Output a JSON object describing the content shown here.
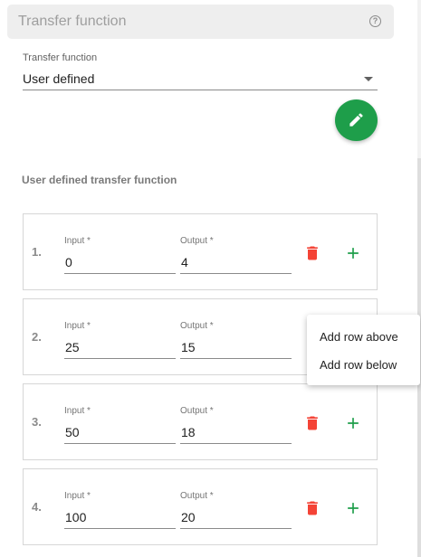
{
  "header": {
    "title": "Transfer function"
  },
  "select": {
    "label": "Transfer function",
    "value": "User defined"
  },
  "section": {
    "title": "User defined transfer function"
  },
  "rows": [
    {
      "index": "1.",
      "input_label": "Input *",
      "input": "0",
      "output_label": "Output *",
      "output": "4"
    },
    {
      "index": "2.",
      "input_label": "Input *",
      "input": "25",
      "output_label": "Output *",
      "output": "15"
    },
    {
      "index": "3.",
      "input_label": "Input *",
      "input": "50",
      "output_label": "Output *",
      "output": "18"
    },
    {
      "index": "4.",
      "input_label": "Input *",
      "input": "100",
      "output_label": "Output *",
      "output": "20"
    }
  ],
  "context_menu": {
    "items": [
      "Add row above",
      "Add row below"
    ]
  },
  "icons": {
    "help": "help-circle-icon",
    "edit": "pencil-icon",
    "delete": "trash-icon",
    "add": "plus-icon",
    "dropdown": "caret-down-icon"
  },
  "colors": {
    "accent_green": "#1e9e4a",
    "delete_red": "#f44336",
    "add_green": "#1e9e4a"
  }
}
